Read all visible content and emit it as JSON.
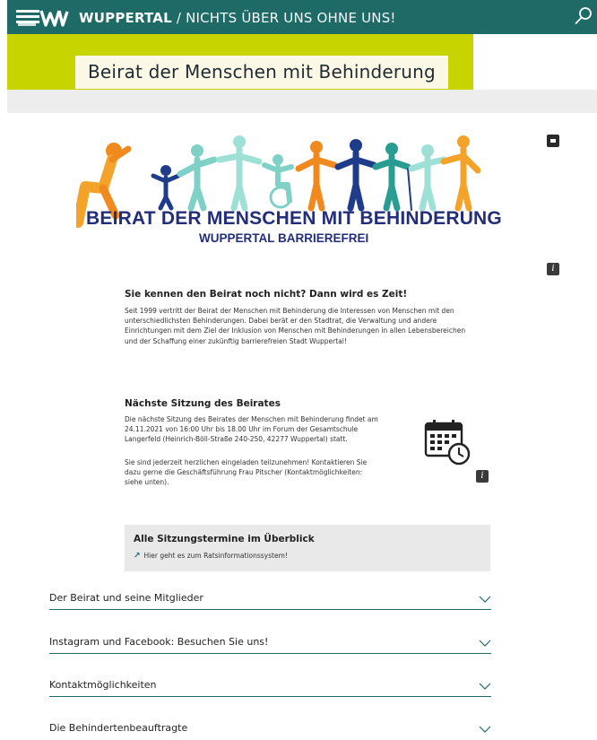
{
  "header": {
    "brand": "WUPPERTAL",
    "separator": " / ",
    "tagline": "NICHTS ÜBER UNS OHNE UNS!"
  },
  "page": {
    "title": "Beirat der Menschen mit Behinderung"
  },
  "hero": {
    "heading": "BEIRAT DER MENSCHEN MIT BEHINDERUNG",
    "subheading": "WUPPERTAL BARRIEREFREI",
    "figure_colors": [
      "#f08a1e",
      "#1f3c8a",
      "#7fd1c7",
      "#f4a32a"
    ]
  },
  "intro": {
    "heading": "Sie kennen den Beirat noch nicht? Dann wird es Zeit!",
    "lines": [
      "Seit 1999 vertritt der Beirat der Menschen mit Behinderung die Interessen von Menschen mit den",
      "unterschiedlichsten Behinderungen. Dabei berät er den Stadtrat, die Verwaltung und andere",
      "Einrichtungen mit dem Ziel der Inklusion von Menschen mit Behinderungen in allen Lebensbereichen",
      "und der Schaffung einer zukünftig barrierefreien Stadt Wuppertal!"
    ]
  },
  "meeting": {
    "heading": "Nächste Sitzung des Beirates",
    "lines1": [
      "Die nächste Sitzung des Beirates der Menschen mit Behinderung findet am",
      "24.11.2021 von 16:00 Uhr bis 18.00 Uhr im Forum der Gesamtschule",
      "Langerfeld (Heinrich-Böll-Straße 240-250, 42277 Wuppertal) statt."
    ],
    "lines2": [
      "Sie sind jederzeit herzlichen eingeladen teilzunehmen! Kontaktieren Sie",
      "dazu gerne die Geschäftsführung Frau Pitscher (Kontaktmöglichkeiten:",
      "siehe unten)."
    ],
    "icon": "calendar-clock-icon"
  },
  "overview": {
    "heading": "Alle Sitzungstermine im Überblick",
    "link_arrow": "↗",
    "link": "Hier geht es zum Ratsinformationssystem!"
  },
  "accordion": [
    {
      "label": "Der Beirat und seine Mitglieder"
    },
    {
      "label": "Instagram und Facebook: Besuchen Sie uns!"
    },
    {
      "label": "Kontaktmöglichkeiten"
    },
    {
      "label": "Die Behindertenbeauftragte"
    }
  ],
  "info_icon_glyph": "i",
  "colors": {
    "header_bg": "#1d6a66",
    "lime": "#c8d400",
    "title_bg": "#fbf8e6",
    "hero_text": "#232e7a",
    "box_bg": "#e9e9e9"
  }
}
